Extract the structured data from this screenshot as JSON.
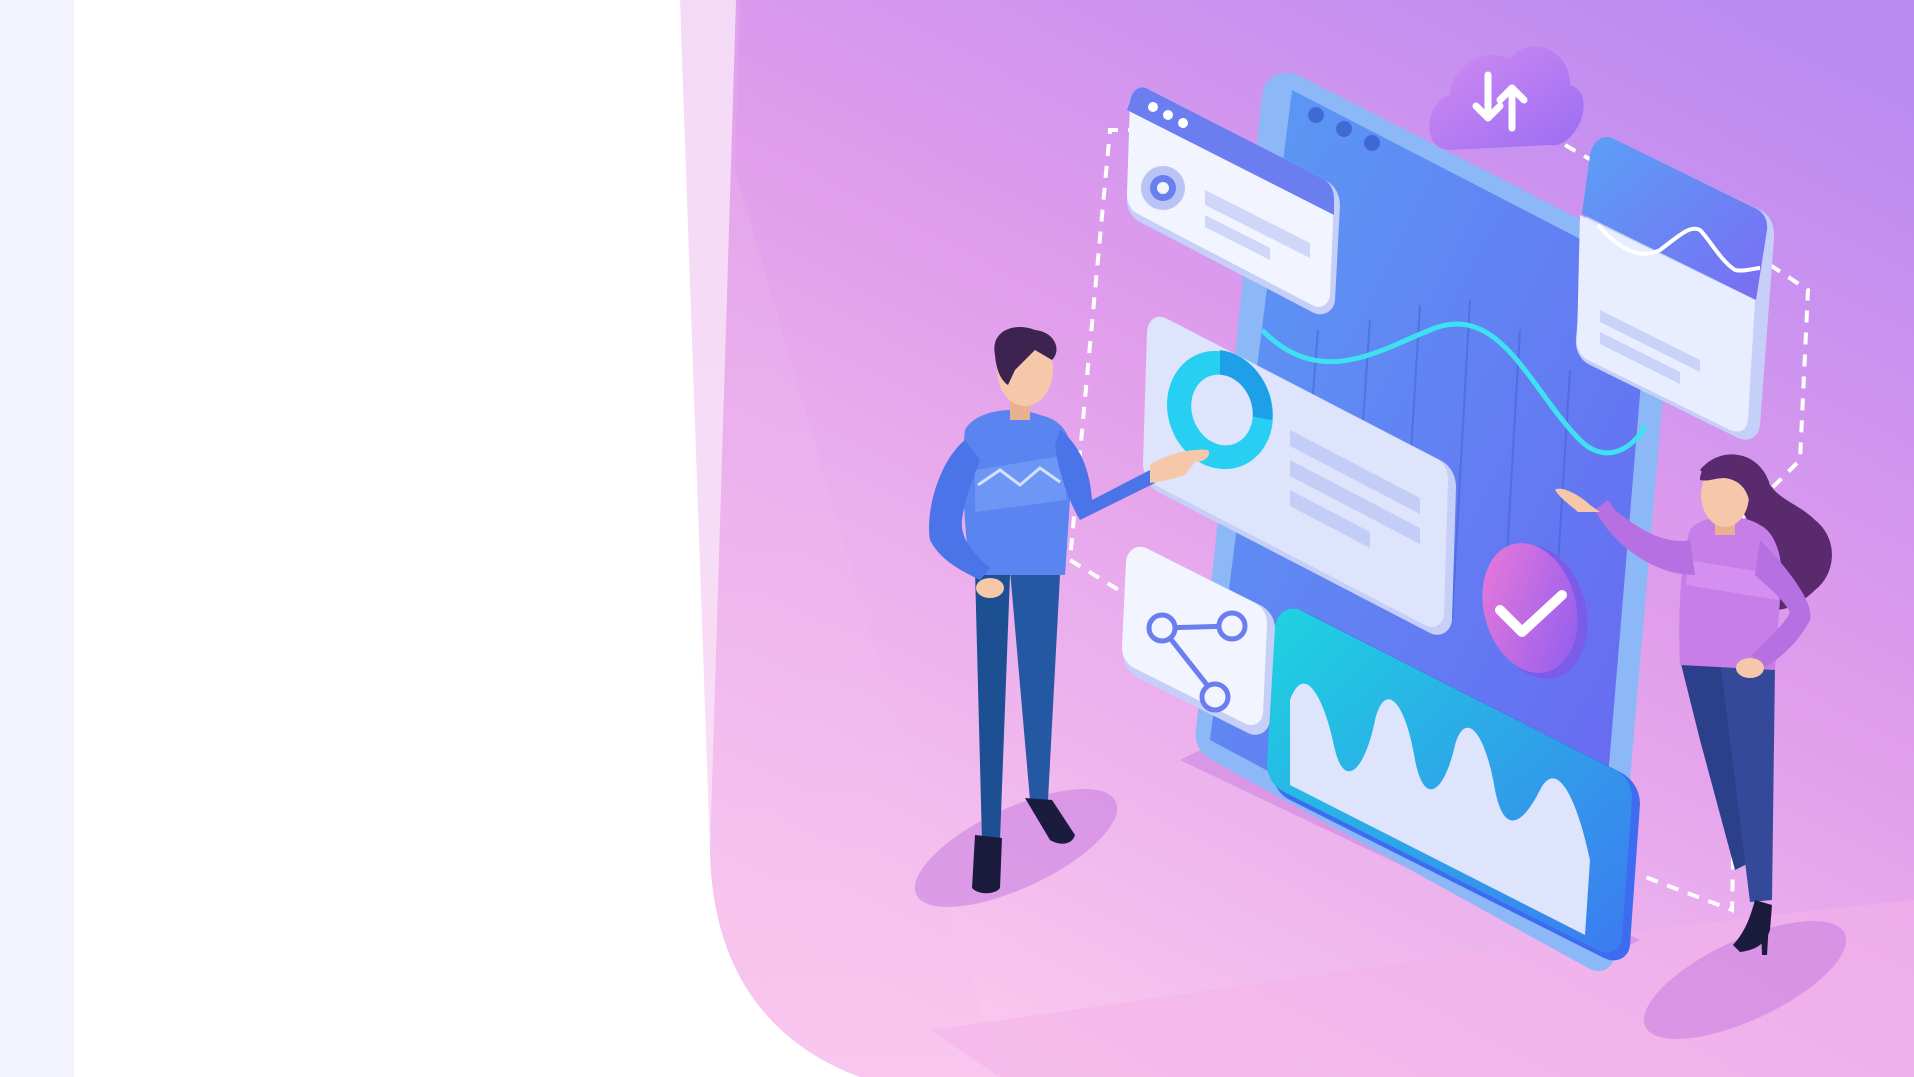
{
  "illustration": {
    "subject": "isometric-people-with-mobile-dashboard",
    "icons": [
      "cloud-sync-icon",
      "share-icon",
      "check-icon",
      "donut-chart-icon",
      "line-chart-icon",
      "area-chart-icon",
      "browser-window-icon"
    ]
  },
  "colors": {
    "sidebar": "#f3f4fd",
    "background": "#ffffff",
    "gradient_top": "#b98af0",
    "gradient_mid": "#e6a0ec",
    "gradient_bottom": "#f8c6ef",
    "phone_blue": "#5b7ff5",
    "card_white": "#f2f5ff",
    "accent_cyan": "#27d0f2",
    "accent_violet": "#8a5cf0",
    "man_sweater": "#5a84f0",
    "man_pants": "#1d4f93",
    "woman_top": "#c77ee8",
    "woman_pants": "#2b3f8a",
    "hair_dark": "#3d2450",
    "hair_woman": "#5a2a6e",
    "skin": "#f6c7a8"
  }
}
